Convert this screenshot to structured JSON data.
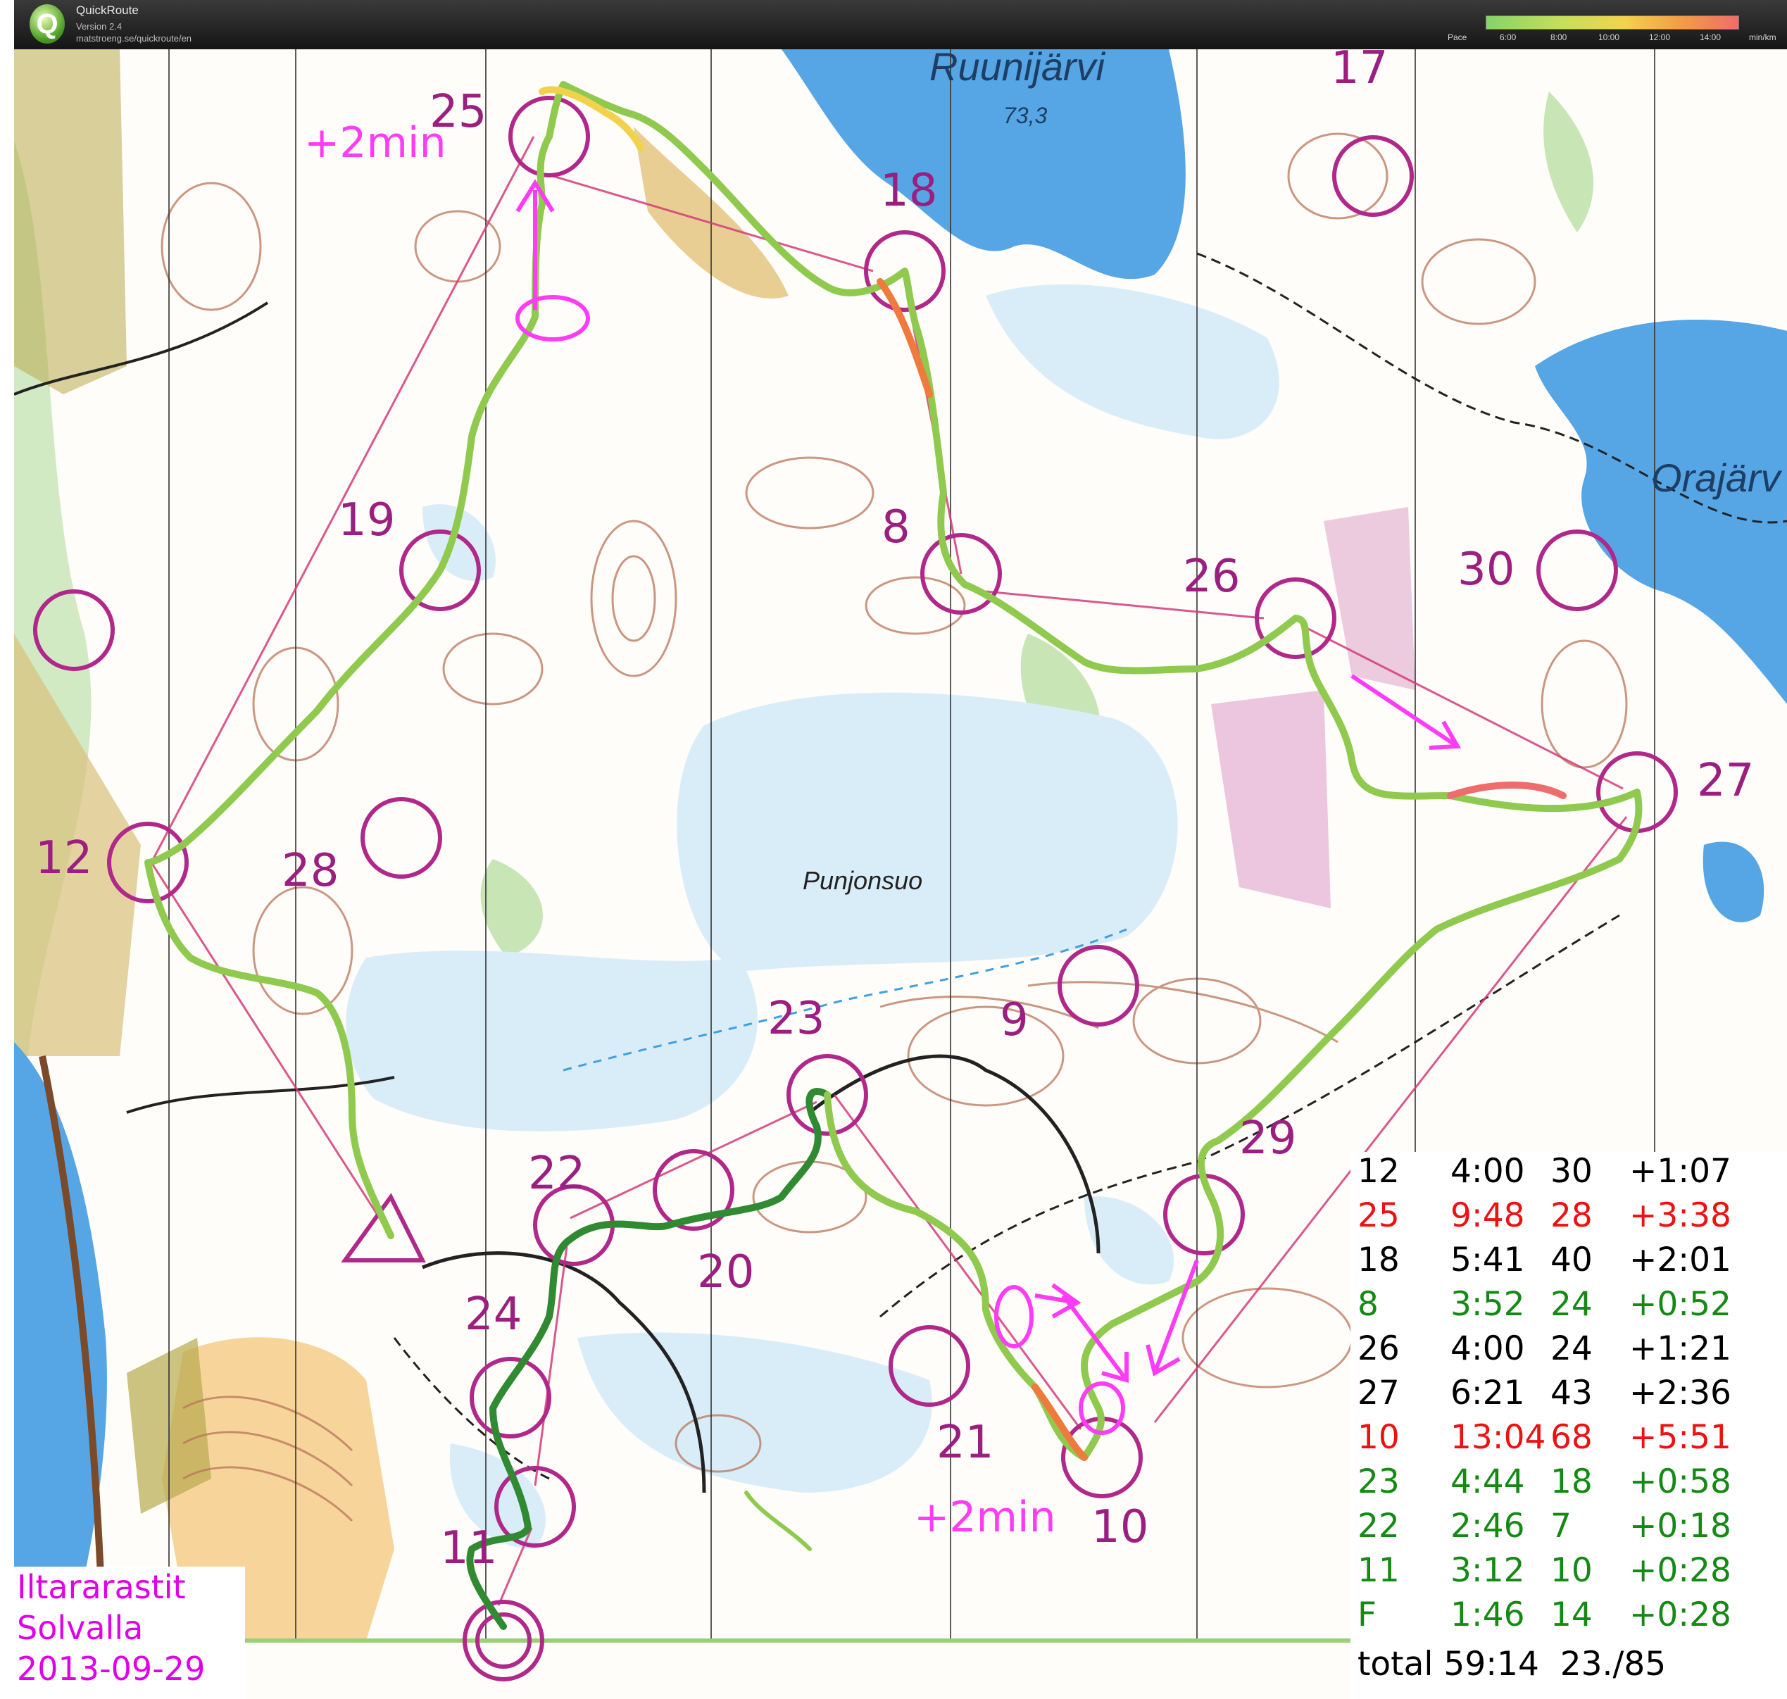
{
  "app": {
    "title": "QuickRoute",
    "version": "Version 2.4",
    "url": "matstroeng.se/quickroute/en",
    "logo_letter": "Q"
  },
  "pace_legend": {
    "label": "Pace",
    "ticks": [
      "6:00",
      "8:00",
      "10:00",
      "12:00",
      "14:00"
    ],
    "unit": "min/km",
    "colors": [
      "#86d36a",
      "#c6df5b",
      "#f2d24d",
      "#f29b47",
      "#ef6c6c"
    ]
  },
  "map": {
    "place_names": [
      "Ruunijärvi",
      "73,3",
      "Orajärv",
      "Punjonsuo"
    ],
    "control_labels": [
      "25",
      "18",
      "17",
      "19",
      "8",
      "26",
      "30",
      "27",
      "12",
      "28",
      "9",
      "23",
      "29",
      "22",
      "20",
      "24",
      "21",
      "10",
      "11"
    ],
    "annotations": [
      "+2min",
      "+2min"
    ],
    "colors": {
      "water": "#56a6e6",
      "marsh_fill": "#d9edf9",
      "open_land": "#f7d49a",
      "vegetation": "#c7e5b5",
      "contour": "#b8745a",
      "control_circle": "#b0288a",
      "course_line": "#d43b7a",
      "route": "#8fca4f",
      "route_fast": "#2f8a31",
      "route_slow": "#f07a3d",
      "annotation": "#ff3cf5"
    }
  },
  "splits": {
    "rows": [
      {
        "control": "12",
        "time": "4:00",
        "rank": "30",
        "loss": "+1:07",
        "color": "#000000"
      },
      {
        "control": "25",
        "time": "9:48",
        "rank": "28",
        "loss": "+3:38",
        "color": "#ee1111"
      },
      {
        "control": "18",
        "time": "5:41",
        "rank": "40",
        "loss": "+2:01",
        "color": "#000000"
      },
      {
        "control": "8",
        "time": "3:52",
        "rank": "24",
        "loss": "+0:52",
        "color": "#148a14"
      },
      {
        "control": "26",
        "time": "4:00",
        "rank": "24",
        "loss": "+1:21",
        "color": "#000000"
      },
      {
        "control": "27",
        "time": "6:21",
        "rank": "43",
        "loss": "+2:36",
        "color": "#000000"
      },
      {
        "control": "10",
        "time": "13:04",
        "rank": "68",
        "loss": "+5:51",
        "color": "#ee1111"
      },
      {
        "control": "23",
        "time": "4:44",
        "rank": "18",
        "loss": "+0:58",
        "color": "#148a14"
      },
      {
        "control": "22",
        "time": "2:46",
        "rank": "7",
        "loss": "+0:18",
        "color": "#148a14"
      },
      {
        "control": "11",
        "time": "3:12",
        "rank": "10",
        "loss": "+0:28",
        "color": "#148a14"
      },
      {
        "control": "F",
        "time": "1:46",
        "rank": "14",
        "loss": "+0:28",
        "color": "#148a14"
      }
    ],
    "total": "total 59:14  23./85"
  },
  "event": {
    "line1": "Iltararastit",
    "line2": "Solvalla",
    "line3": "2013-09-29"
  }
}
